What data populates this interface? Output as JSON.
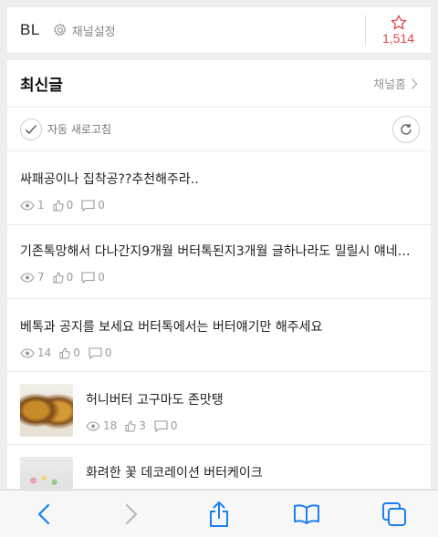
{
  "header": {
    "brand": "BL",
    "settings_label": "채널설정",
    "star_count": "1,514"
  },
  "panel": {
    "title": "최신글",
    "channel_home": "채널홈",
    "auto_refresh": "자동 새로고침"
  },
  "posts": [
    {
      "title": "싸패공이나 집착공??추천해주라..",
      "views": "1",
      "likes": "0",
      "comments": "0"
    },
    {
      "title": "기존톡망해서 다나간지9개월 버터톡된지3개월 글하나라도 밀릴시 얘네들...",
      "views": "7",
      "likes": "0",
      "comments": "0"
    },
    {
      "title": "베톡과 공지를 보세요 버터톡에서는 버터얘기만 해주세요",
      "views": "14",
      "likes": "0",
      "comments": "0"
    },
    {
      "title": "허니버터 고구마도 존맛탱",
      "views": "18",
      "likes": "3",
      "comments": "0"
    },
    {
      "title": "화려한 꽃 데코레이션 버터케이크",
      "views": "",
      "likes": "",
      "comments": ""
    }
  ],
  "colors": {
    "accent_red": "#e04848",
    "ios_blue": "#1a7ff0"
  },
  "toolbar_icons": [
    "back-icon",
    "forward-icon",
    "share-icon",
    "bookmarks-icon",
    "tabs-icon"
  ]
}
